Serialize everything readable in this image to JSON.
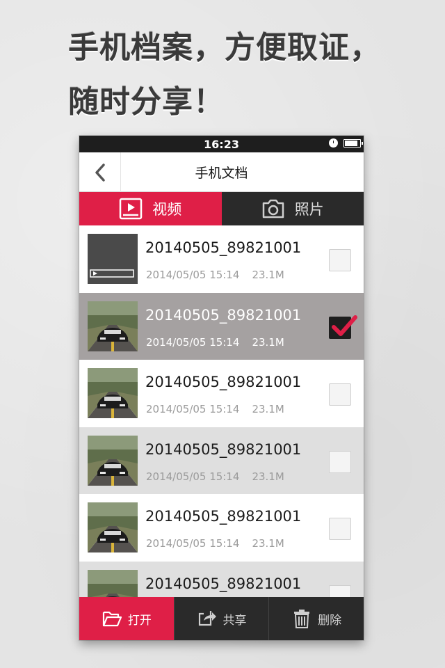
{
  "headline": {
    "line1": "手机档案，方便取证，",
    "line2": "随时分享！"
  },
  "status_bar": {
    "time": "16:23"
  },
  "nav": {
    "title": "手机文档"
  },
  "tabs": [
    {
      "label": "视频",
      "icon": "video-icon",
      "active": true
    },
    {
      "label": "照片",
      "icon": "camera-icon",
      "active": false
    }
  ],
  "files": [
    {
      "name": "20140505_89821001",
      "date": "2014/05/05 15:14",
      "size": "23.1M",
      "checked": false,
      "thumb": "video-placeholder"
    },
    {
      "name": "20140505_89821001",
      "date": "2014/05/05 15:14",
      "size": "23.1M",
      "checked": true,
      "thumb": "car"
    },
    {
      "name": "20140505_89821001",
      "date": "2014/05/05 15:14",
      "size": "23.1M",
      "checked": false,
      "thumb": "car"
    },
    {
      "name": "20140505_89821001",
      "date": "2014/05/05 15:14",
      "size": "23.1M",
      "checked": false,
      "thumb": "car"
    },
    {
      "name": "20140505_89821001",
      "date": "2014/05/05 15:14",
      "size": "23.1M",
      "checked": false,
      "thumb": "car"
    },
    {
      "name": "20140505_89821001",
      "date": "",
      "size": "",
      "checked": false,
      "thumb": "car"
    }
  ],
  "toolbar": {
    "open_label": "打开",
    "share_label": "共享",
    "delete_label": "删除"
  },
  "colors": {
    "accent": "#df1f47",
    "dark": "#2a2a2a",
    "selected_row": "#a5a1a1"
  }
}
